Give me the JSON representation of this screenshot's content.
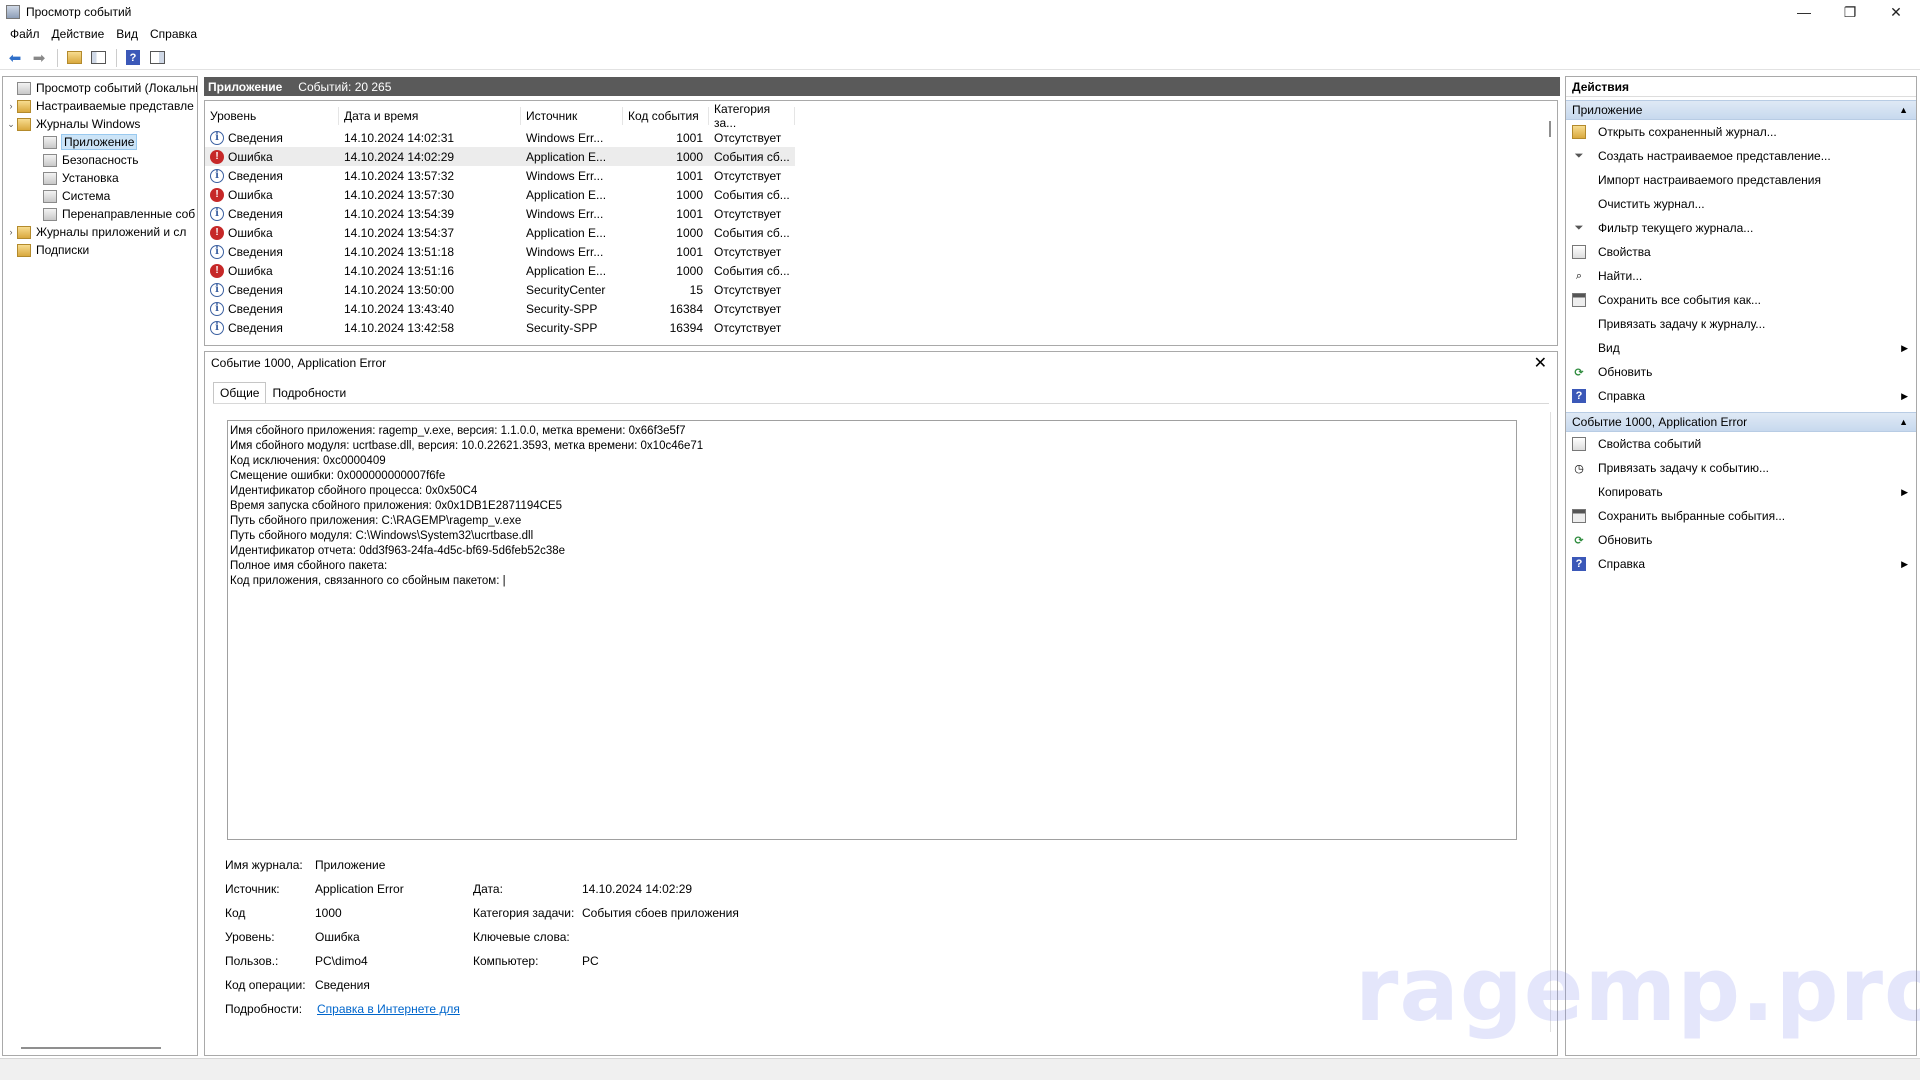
{
  "window": {
    "title": "Просмотр событий",
    "minimize_icon": "—",
    "restore_icon": "❐",
    "close_icon": "✕"
  },
  "menu": [
    "Файл",
    "Действие",
    "Вид",
    "Справка"
  ],
  "tree": {
    "root": "Просмотр событий (Локальны",
    "custom_views": "Настраиваемые представле",
    "windows_logs": "Журналы Windows",
    "application": "Приложение",
    "security": "Безопасность",
    "setup": "Установка",
    "system": "Система",
    "forwarded": "Перенаправленные соб",
    "app_service_logs": "Журналы приложений и сл",
    "subscriptions": "Подписки"
  },
  "list": {
    "title": "Приложение",
    "count": "Событий: 20 265",
    "columns": [
      "Уровень",
      "Дата и время",
      "Источник",
      "Код события",
      "Категория за..."
    ],
    "rows": [
      {
        "level": "Сведения",
        "type": "info",
        "datetime": "14.10.2024 14:02:31",
        "source": "Windows Err...",
        "id": "1001",
        "category": "Отсутствует"
      },
      {
        "level": "Ошибка",
        "type": "error",
        "datetime": "14.10.2024 14:02:29",
        "source": "Application E...",
        "id": "1000",
        "category": "События сб..."
      },
      {
        "level": "Сведения",
        "type": "info",
        "datetime": "14.10.2024 13:57:32",
        "source": "Windows Err...",
        "id": "1001",
        "category": "Отсутствует"
      },
      {
        "level": "Ошибка",
        "type": "error",
        "datetime": "14.10.2024 13:57:30",
        "source": "Application E...",
        "id": "1000",
        "category": "События сб..."
      },
      {
        "level": "Сведения",
        "type": "info",
        "datetime": "14.10.2024 13:54:39",
        "source": "Windows Err...",
        "id": "1001",
        "category": "Отсутствует"
      },
      {
        "level": "Ошибка",
        "type": "error",
        "datetime": "14.10.2024 13:54:37",
        "source": "Application E...",
        "id": "1000",
        "category": "События сб..."
      },
      {
        "level": "Сведения",
        "type": "info",
        "datetime": "14.10.2024 13:51:18",
        "source": "Windows Err...",
        "id": "1001",
        "category": "Отсутствует"
      },
      {
        "level": "Ошибка",
        "type": "error",
        "datetime": "14.10.2024 13:51:16",
        "source": "Application E...",
        "id": "1000",
        "category": "События сб..."
      },
      {
        "level": "Сведения",
        "type": "info",
        "datetime": "14.10.2024 13:50:00",
        "source": "SecurityCenter",
        "id": "15",
        "category": "Отсутствует"
      },
      {
        "level": "Сведения",
        "type": "info",
        "datetime": "14.10.2024 13:43:40",
        "source": "Security-SPP",
        "id": "16384",
        "category": "Отсутствует"
      },
      {
        "level": "Сведения",
        "type": "info",
        "datetime": "14.10.2024 13:42:58",
        "source": "Security-SPP",
        "id": "16394",
        "category": "Отсутствует"
      }
    ]
  },
  "detail": {
    "title": "Событие 1000, Application Error",
    "tab_general": "Общие",
    "tab_details": "Подробности",
    "message": "Имя сбойного приложения: ragemp_v.exe, версия: 1.1.0.0, метка времени: 0x66f3e5f7\nИмя сбойного модуля: ucrtbase.dll, версия: 10.0.22621.3593, метка времени: 0x10c46e71\nКод исключения: 0xc0000409\nСмещение ошибки: 0x000000000007f6fe\nИдентификатор сбойного процесса: 0x0x50C4\nВремя запуска сбойного приложения: 0x0x1DB1E2871194CE5\nПуть сбойного приложения: C:\\RAGEMP\\ragemp_v.exe\nПуть сбойного модуля: C:\\Windows\\System32\\ucrtbase.dll\nИдентификатор отчета: 0dd3f963-24fa-4d5c-bf69-5d6feb52c38e\nПолное имя сбойного пакета:\nКод приложения, связанного со сбойным пакетом: |",
    "props": {
      "log_label": "Имя журнала:",
      "log_value": "Приложение",
      "source_label": "Источник:",
      "source_value": "Application Error",
      "date_label": "Дата:",
      "date_value": "14.10.2024 14:02:29",
      "code_label": "Код",
      "code_value": "1000",
      "task_label": "Категория задачи:",
      "task_value": "События сбоев приложения",
      "level_label": "Уровень:",
      "level_value": "Ошибка",
      "keywords_label": "Ключевые слова:",
      "user_label": "Пользов.:",
      "user_value": "PC\\dimo4",
      "computer_label": "Компьютер:",
      "computer_value": "PC",
      "opcode_label": "Код операции:",
      "opcode_value": "Сведения",
      "more_label": "Подробности:",
      "more_link": "Справка в Интернете для"
    }
  },
  "actions": {
    "header": "Действия",
    "section1": "Приложение",
    "items1": [
      {
        "label": "Открыть сохраненный журнал...",
        "icon": "open-log-icon"
      },
      {
        "label": "Создать настраиваемое представление...",
        "icon": "filter-create-icon"
      },
      {
        "label": "Импорт настраиваемого представления",
        "icon": ""
      },
      {
        "label": "Очистить журнал...",
        "icon": ""
      },
      {
        "label": "Фильтр текущего журнала...",
        "icon": "filter-icon"
      },
      {
        "label": "Свойства",
        "icon": "properties-icon"
      },
      {
        "label": "Найти...",
        "icon": "find-icon"
      },
      {
        "label": "Сохранить все события как...",
        "icon": "save-icon"
      },
      {
        "label": "Привязать задачу к журналу...",
        "icon": ""
      },
      {
        "label": "Вид",
        "icon": "",
        "submenu": true
      },
      {
        "label": "Обновить",
        "icon": "refresh-icon"
      },
      {
        "label": "Справка",
        "icon": "help-icon",
        "submenu": true
      }
    ],
    "section2": "Событие 1000, Application Error",
    "items2": [
      {
        "label": "Свойства событий",
        "icon": "event-properties-icon"
      },
      {
        "label": "Привязать задачу к событию...",
        "icon": "attach-task-icon"
      },
      {
        "label": "Копировать",
        "icon": "",
        "submenu": true
      },
      {
        "label": "Сохранить выбранные события...",
        "icon": "save-icon"
      },
      {
        "label": "Обновить",
        "icon": "refresh-icon"
      },
      {
        "label": "Справка",
        "icon": "help-icon",
        "submenu": true
      }
    ]
  },
  "watermark": "ragemp.pro"
}
